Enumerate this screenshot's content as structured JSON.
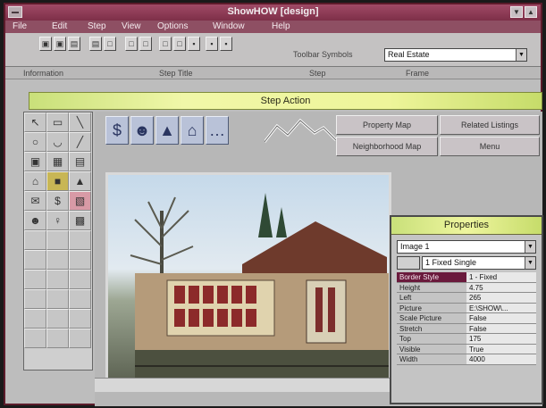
{
  "window": {
    "title": "ShowHOW [design]"
  },
  "menu": [
    "File",
    "Edit",
    "Step",
    "View",
    "Options",
    "Window",
    "Help"
  ],
  "toolbar": {
    "symbols_label": "Toolbar Symbols",
    "symbols_value": "Real Estate",
    "row_labels": [
      "Information",
      "Step Title",
      "Step",
      "Frame"
    ],
    "button_glyphs": [
      "▣",
      "▣",
      "▤",
      "▤",
      "□",
      "□",
      "□",
      "□",
      "□",
      "▪",
      "▪",
      "▪"
    ]
  },
  "step_bar": {
    "label": "Step Action"
  },
  "toolbox": {
    "glyphs": [
      "↖",
      "▭",
      "╲",
      "○",
      "◡",
      "╱",
      "▣",
      "▦",
      "▤",
      "⌂",
      "■",
      "▲",
      "✉",
      "$",
      "▧",
      "☻",
      "♀",
      "▩"
    ]
  },
  "action_icons": {
    "glyphs": [
      "$",
      "☻",
      "▲",
      "⌂",
      "…"
    ]
  },
  "nav_buttons": {
    "property_map": "Property Map",
    "related_listing": "Related Listings",
    "neighborhood_map": "Neighborhood Map",
    "menu": "Menu"
  },
  "properties_panel": {
    "title": "Properties",
    "object": "Image 1",
    "border": "1 Fixed Single",
    "rows": [
      {
        "key": "Border Style",
        "value": "1 - Fixed",
        "selected": true
      },
      {
        "key": "Height",
        "value": "4.75"
      },
      {
        "key": "Left",
        "value": "265"
      },
      {
        "key": "Picture",
        "value": "E:\\SHOW\\..."
      },
      {
        "key": "Scale Picture",
        "value": "False"
      },
      {
        "key": "Stretch",
        "value": "False"
      },
      {
        "key": "Top",
        "value": "175"
      },
      {
        "key": "Visible",
        "value": "True"
      },
      {
        "key": "Width",
        "value": "4000"
      }
    ]
  },
  "colors": {
    "titlebar": "#8a3c56",
    "menubar": "#8e4f63",
    "accent_bar": "#eef59a",
    "selected_row": "#6a1a3c"
  }
}
